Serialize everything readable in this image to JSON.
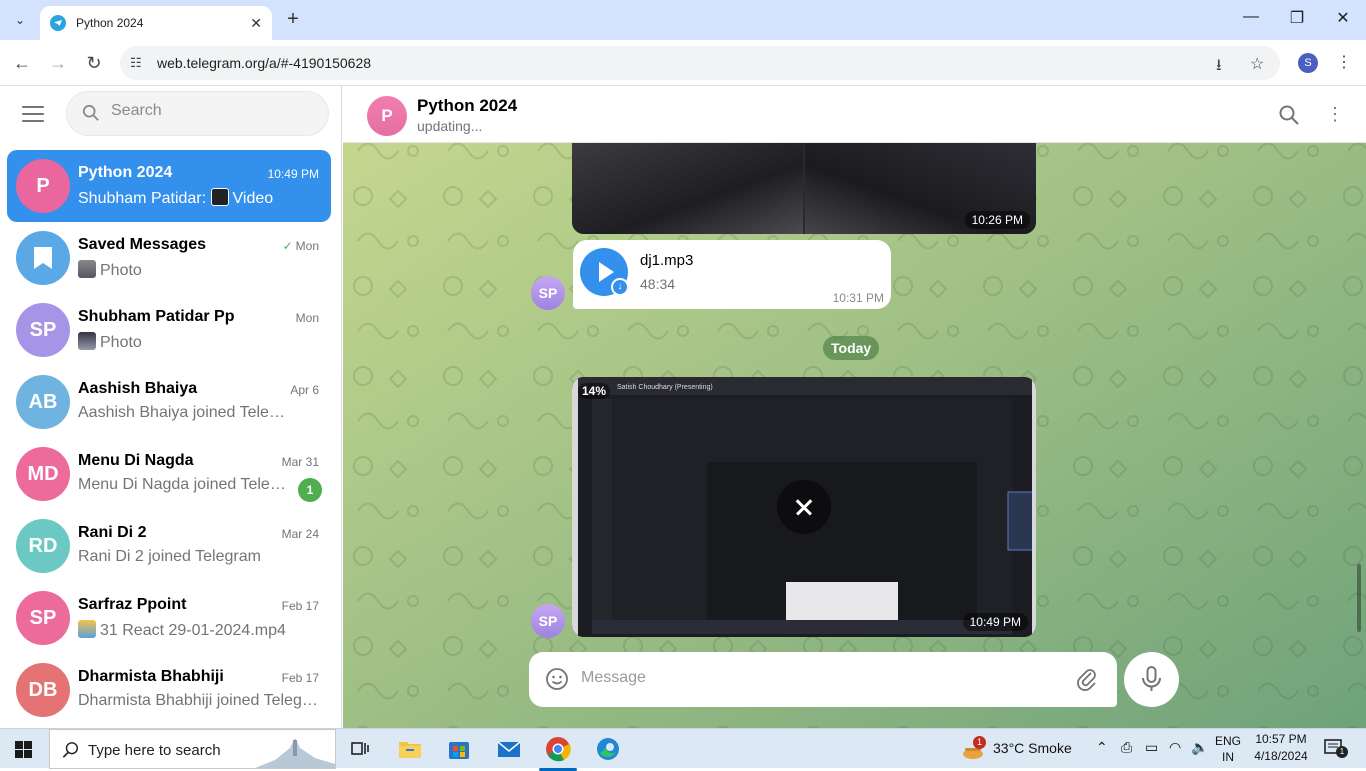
{
  "browser": {
    "tab_title": "Python 2024",
    "url": "web.telegram.org/a/#-4190150628",
    "profile_initial": "S"
  },
  "sidebar": {
    "search_placeholder": "Search",
    "chats": [
      {
        "avatar_text": "P",
        "avatar_color": "#e9669e",
        "name": "Python 2024",
        "time": "10:49 PM",
        "message_prefix": "Shubham Patidar:",
        "message": "Video",
        "active": true
      },
      {
        "avatar_text": "",
        "avatar_icon": "bookmark-icon",
        "avatar_color": "#5aa9e6",
        "name": "Saved Messages",
        "time": "Mon",
        "read": true,
        "message": "Photo"
      },
      {
        "avatar_text": "SP",
        "avatar_color": "#a695e7",
        "name": "Shubham Patidar Pp",
        "time": "Mon",
        "message": "Photo"
      },
      {
        "avatar_text": "AB",
        "avatar_color": "#6fb3e0",
        "name": "Aashish Bhaiya",
        "time": "Apr 6",
        "message": "Aashish Bhaiya joined Telegram"
      },
      {
        "avatar_text": "MD",
        "avatar_color": "#ec6b9a",
        "name": "Menu Di Nagda",
        "time": "Mar 31",
        "message": "Menu Di Nagda joined Telegram",
        "unread": "1"
      },
      {
        "avatar_text": "RD",
        "avatar_color": "#6cc8c2",
        "name": "Rani Di 2",
        "time": "Mar 24",
        "message": "Rani Di 2 joined Telegram"
      },
      {
        "avatar_text": "SP",
        "avatar_color": "#ec6b9a",
        "name": "Sarfraz Ppoint",
        "time": "Feb 17",
        "message": "31 React 29-01-2024.mp4"
      },
      {
        "avatar_text": "DB",
        "avatar_color": "#e57373",
        "name": "Dharmista Bhabhiji",
        "time": "Feb 17",
        "message": "Dharmista Bhabhiji joined Telegram"
      }
    ]
  },
  "chat": {
    "avatar_text": "P",
    "title": "Python 2024",
    "status": "updating...",
    "messages": {
      "top_photo_time": "10:26 PM",
      "audio": {
        "sender_initials": "SP",
        "name": "dj1.mp3",
        "duration": "48:34",
        "time": "10:31 PM"
      },
      "date_divider": "Today",
      "video": {
        "sender_initials": "SP",
        "download_progress": "14%",
        "time": "10:49 PM",
        "caption_in_frame": "Satish Choudhary (Presenting)"
      }
    },
    "composer_placeholder": "Message"
  },
  "taskbar": {
    "search_placeholder": "Type here to search",
    "weather": "33°C  Smoke",
    "weather_badge": "1",
    "lang_top": "ENG",
    "lang_bottom": "IN",
    "time": "10:57 PM",
    "date": "4/18/2024",
    "notification_count": "1"
  }
}
